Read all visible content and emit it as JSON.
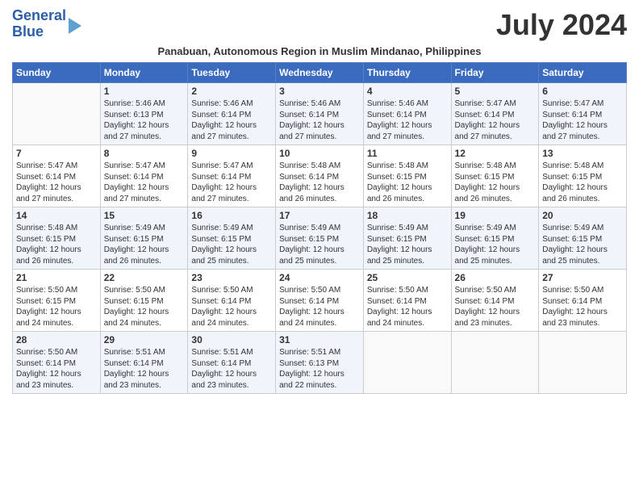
{
  "logo": {
    "line1": "General",
    "line2": "Blue"
  },
  "title": "July 2024",
  "subtitle": "Panabuan, Autonomous Region in Muslim Mindanao, Philippines",
  "days_of_week": [
    "Sunday",
    "Monday",
    "Tuesday",
    "Wednesday",
    "Thursday",
    "Friday",
    "Saturday"
  ],
  "weeks": [
    [
      {
        "day": "",
        "info": ""
      },
      {
        "day": "1",
        "info": "Sunrise: 5:46 AM\nSunset: 6:13 PM\nDaylight: 12 hours\nand 27 minutes."
      },
      {
        "day": "2",
        "info": "Sunrise: 5:46 AM\nSunset: 6:14 PM\nDaylight: 12 hours\nand 27 minutes."
      },
      {
        "day": "3",
        "info": "Sunrise: 5:46 AM\nSunset: 6:14 PM\nDaylight: 12 hours\nand 27 minutes."
      },
      {
        "day": "4",
        "info": "Sunrise: 5:46 AM\nSunset: 6:14 PM\nDaylight: 12 hours\nand 27 minutes."
      },
      {
        "day": "5",
        "info": "Sunrise: 5:47 AM\nSunset: 6:14 PM\nDaylight: 12 hours\nand 27 minutes."
      },
      {
        "day": "6",
        "info": "Sunrise: 5:47 AM\nSunset: 6:14 PM\nDaylight: 12 hours\nand 27 minutes."
      }
    ],
    [
      {
        "day": "7",
        "info": "Sunrise: 5:47 AM\nSunset: 6:14 PM\nDaylight: 12 hours\nand 27 minutes."
      },
      {
        "day": "8",
        "info": "Sunrise: 5:47 AM\nSunset: 6:14 PM\nDaylight: 12 hours\nand 27 minutes."
      },
      {
        "day": "9",
        "info": "Sunrise: 5:47 AM\nSunset: 6:14 PM\nDaylight: 12 hours\nand 27 minutes."
      },
      {
        "day": "10",
        "info": "Sunrise: 5:48 AM\nSunset: 6:14 PM\nDaylight: 12 hours\nand 26 minutes."
      },
      {
        "day": "11",
        "info": "Sunrise: 5:48 AM\nSunset: 6:15 PM\nDaylight: 12 hours\nand 26 minutes."
      },
      {
        "day": "12",
        "info": "Sunrise: 5:48 AM\nSunset: 6:15 PM\nDaylight: 12 hours\nand 26 minutes."
      },
      {
        "day": "13",
        "info": "Sunrise: 5:48 AM\nSunset: 6:15 PM\nDaylight: 12 hours\nand 26 minutes."
      }
    ],
    [
      {
        "day": "14",
        "info": "Sunrise: 5:48 AM\nSunset: 6:15 PM\nDaylight: 12 hours\nand 26 minutes."
      },
      {
        "day": "15",
        "info": "Sunrise: 5:49 AM\nSunset: 6:15 PM\nDaylight: 12 hours\nand 26 minutes."
      },
      {
        "day": "16",
        "info": "Sunrise: 5:49 AM\nSunset: 6:15 PM\nDaylight: 12 hours\nand 25 minutes."
      },
      {
        "day": "17",
        "info": "Sunrise: 5:49 AM\nSunset: 6:15 PM\nDaylight: 12 hours\nand 25 minutes."
      },
      {
        "day": "18",
        "info": "Sunrise: 5:49 AM\nSunset: 6:15 PM\nDaylight: 12 hours\nand 25 minutes."
      },
      {
        "day": "19",
        "info": "Sunrise: 5:49 AM\nSunset: 6:15 PM\nDaylight: 12 hours\nand 25 minutes."
      },
      {
        "day": "20",
        "info": "Sunrise: 5:49 AM\nSunset: 6:15 PM\nDaylight: 12 hours\nand 25 minutes."
      }
    ],
    [
      {
        "day": "21",
        "info": "Sunrise: 5:50 AM\nSunset: 6:15 PM\nDaylight: 12 hours\nand 24 minutes."
      },
      {
        "day": "22",
        "info": "Sunrise: 5:50 AM\nSunset: 6:15 PM\nDaylight: 12 hours\nand 24 minutes."
      },
      {
        "day": "23",
        "info": "Sunrise: 5:50 AM\nSunset: 6:14 PM\nDaylight: 12 hours\nand 24 minutes."
      },
      {
        "day": "24",
        "info": "Sunrise: 5:50 AM\nSunset: 6:14 PM\nDaylight: 12 hours\nand 24 minutes."
      },
      {
        "day": "25",
        "info": "Sunrise: 5:50 AM\nSunset: 6:14 PM\nDaylight: 12 hours\nand 24 minutes."
      },
      {
        "day": "26",
        "info": "Sunrise: 5:50 AM\nSunset: 6:14 PM\nDaylight: 12 hours\nand 23 minutes."
      },
      {
        "day": "27",
        "info": "Sunrise: 5:50 AM\nSunset: 6:14 PM\nDaylight: 12 hours\nand 23 minutes."
      }
    ],
    [
      {
        "day": "28",
        "info": "Sunrise: 5:50 AM\nSunset: 6:14 PM\nDaylight: 12 hours\nand 23 minutes."
      },
      {
        "day": "29",
        "info": "Sunrise: 5:51 AM\nSunset: 6:14 PM\nDaylight: 12 hours\nand 23 minutes."
      },
      {
        "day": "30",
        "info": "Sunrise: 5:51 AM\nSunset: 6:14 PM\nDaylight: 12 hours\nand 23 minutes."
      },
      {
        "day": "31",
        "info": "Sunrise: 5:51 AM\nSunset: 6:13 PM\nDaylight: 12 hours\nand 22 minutes."
      },
      {
        "day": "",
        "info": ""
      },
      {
        "day": "",
        "info": ""
      },
      {
        "day": "",
        "info": ""
      }
    ]
  ]
}
